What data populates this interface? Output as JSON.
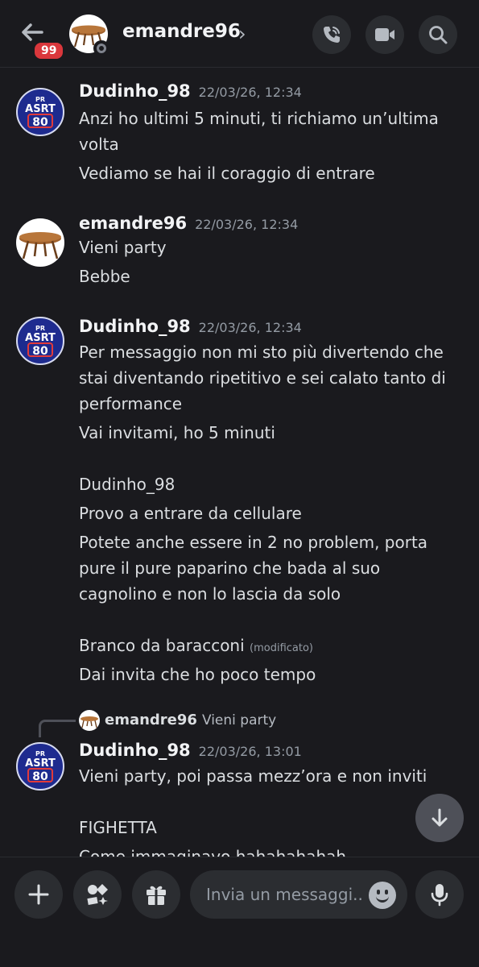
{
  "header": {
    "unread_badge": "99",
    "title": "emandre96",
    "chevron": "›"
  },
  "avatars": {
    "asrt_top": "PR",
    "asrt_mid": "ASRT",
    "asrt_num": "80"
  },
  "messages": [
    {
      "author": "Dudinho_98",
      "timestamp": "22/03/26, 12:34",
      "lines": [
        "Anzi ho ultimi 5 minuti, ti richiamo un’ultima",
        "volta",
        "Vediamo se hai il coraggio di entrare"
      ]
    },
    {
      "author": "emandre96",
      "timestamp": "22/03/26, 12:34",
      "lines": [
        "Vieni party",
        "Bebbe"
      ]
    },
    {
      "author": "Dudinho_98",
      "timestamp": "22/03/26, 12:34",
      "lines": [
        "Per messaggio non mi sto più divertendo che",
        "stai diventando ripetitivo e sei calato tanto di",
        "performance",
        "Vai invitami, ho 5 minuti",
        "",
        "Dudinho_98",
        "Provo a entrare da cellulare",
        "Potete anche essere in 2 no problem, porta",
        "pure il pure paparino che bada al suo",
        "cagnolino e non lo lascia da solo",
        "",
        "Branco da baracconi",
        "Dai invita che ho poco tempo"
      ],
      "edited_label": "(modificato)"
    },
    {
      "reply_to_author": "emandre96",
      "reply_to_text": "Vieni party",
      "author": "Dudinho_98",
      "timestamp": "22/03/26, 13:01",
      "lines": [
        "Vieni party, poi passa mezz’ora e non inviti",
        "",
        "FIGHETTA",
        "Come immaginavo hahahahahah"
      ]
    }
  ],
  "composer": {
    "placeholder": "Invia un messaggi.."
  },
  "icons": [
    "back-arrow-icon",
    "call-icon",
    "video-icon",
    "search-icon",
    "arrow-down-icon",
    "plus-icon",
    "apps-icon",
    "gift-icon",
    "emoji-icon",
    "microphone-icon"
  ],
  "colors": {
    "background": "#1a1a1e",
    "badge": "#da373c",
    "button": "#2b2d31"
  }
}
